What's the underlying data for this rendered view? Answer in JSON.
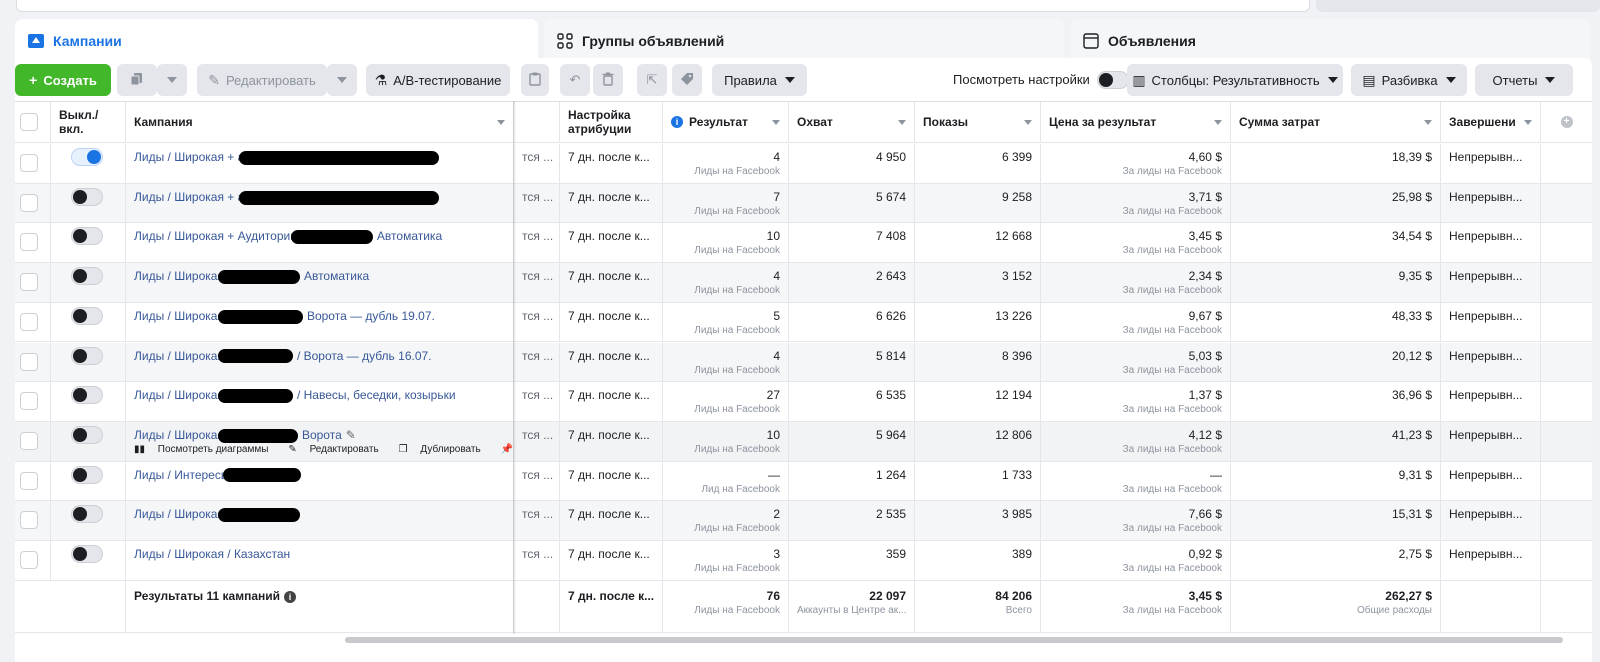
{
  "tabs": [
    {
      "label": "Кампании",
      "icon": "folder-icon",
      "active": true
    },
    {
      "label": "Группы объявлений",
      "icon": "grid-icon"
    },
    {
      "label": "Объявления",
      "icon": "ad-window-icon"
    }
  ],
  "toolbar": {
    "create_label": "Создать",
    "edit_label": "Редактировать",
    "ab_test_label": "A/B-тестирование",
    "rules_label": "Правила",
    "view_settings_label": "Посмотреть настройки",
    "columns_label": "Столбцы: Результативность",
    "breakdown_label": "Разбивка",
    "reports_label": "Отчеты"
  },
  "columns": {
    "onoff": "Выкл./ вкл.",
    "campaign": "Кампания",
    "attribution": "Настройка атрибуции",
    "result": "Результат",
    "reach": "Охват",
    "impressions": "Показы",
    "cost_per_result": "Цена за результат",
    "spend": "Сумма затрат",
    "ends": "Завершени"
  },
  "rows": [
    {
      "on": true,
      "name": "Лиды / Широкая + аудит.",
      "name_suffix": "",
      "delivery": "тся ...",
      "attribution": "7 дн. после к...",
      "result": "4",
      "result_sub": "Лиды на Facebook",
      "reach": "4 950",
      "impressions": "6 399",
      "cpr": "4,60 $",
      "cpr_sub": "За лиды на Facebook",
      "spend": "18,39 $",
      "ends": "Непрерывн..."
    },
    {
      "on": false,
      "name": "Лиды / Широкая + аудит.",
      "name_suffix": "",
      "delivery": "тся ...",
      "attribution": "7 дн. после к...",
      "result": "7",
      "result_sub": "Лиды на Facebook",
      "reach": "5 674",
      "impressions": "9 258",
      "cpr": "3,71 $",
      "cpr_sub": "За лиды на Facebook",
      "spend": "25,98 $",
      "ends": "Непрерывн..."
    },
    {
      "on": false,
      "name": "Лиды / Широкая + Аудитории",
      "name_suffix": "Автоматика",
      "delivery": "тся ...",
      "attribution": "7 дн. после к...",
      "result": "10",
      "result_sub": "Лиды на Facebook",
      "reach": "7 408",
      "impressions": "12 668",
      "cpr": "3,45 $",
      "cpr_sub": "За лиды на Facebook",
      "spend": "34,54 $",
      "ends": "Непрерывн..."
    },
    {
      "on": false,
      "name": "Лиды / Широкая",
      "name_suffix": "Автоматика",
      "delivery": "тся ...",
      "attribution": "7 дн. после к...",
      "result": "4",
      "result_sub": "Лиды на Facebook",
      "reach": "2 643",
      "impressions": "3 152",
      "cpr": "2,34 $",
      "cpr_sub": "За лиды на Facebook",
      "spend": "9,35 $",
      "ends": "Непрерывн..."
    },
    {
      "on": false,
      "name": "Лиды / Широкая",
      "name_suffix": "Ворота — дубль 19.07.",
      "delivery": "тся ...",
      "attribution": "7 дн. после к...",
      "result": "5",
      "result_sub": "Лиды на Facebook",
      "reach": "6 626",
      "impressions": "13 226",
      "cpr": "9,67 $",
      "cpr_sub": "За лиды на Facebook",
      "spend": "48,33 $",
      "ends": "Непрерывн..."
    },
    {
      "on": false,
      "name": "Лиды / Широкая",
      "name_suffix": "/ Ворота — дубль 16.07.",
      "delivery": "тся ...",
      "attribution": "7 дн. после к...",
      "result": "4",
      "result_sub": "Лиды на Facebook",
      "reach": "5 814",
      "impressions": "8 396",
      "cpr": "5,03 $",
      "cpr_sub": "За лиды на Facebook",
      "spend": "20,12 $",
      "ends": "Непрерывн..."
    },
    {
      "on": false,
      "name": "Лиды / Широкая",
      "name_suffix": "/ Навесы, беседки, козырьки",
      "delivery": "тся ...",
      "attribution": "7 дн. после к...",
      "result": "27",
      "result_sub": "Лиды на Facebook",
      "reach": "6 535",
      "impressions": "12 194",
      "cpr": "1,37 $",
      "cpr_sub": "За лиды на Facebook",
      "spend": "36,96 $",
      "ends": "Непрерывн..."
    },
    {
      "on": false,
      "name": "Лиды / Широкая",
      "name_suffix": "Ворота",
      "delivery": "тся ...",
      "attribution": "7 дн. после к...",
      "result": "10",
      "result_sub": "Лиды на Facebook",
      "reach": "5 964",
      "impressions": "12 806",
      "cpr": "4,12 $",
      "cpr_sub": "За лиды на Facebook",
      "spend": "41,23 $",
      "ends": "Непрерывн..."
    },
    {
      "on": false,
      "name": "Лиды / Интересы",
      "name_suffix": "",
      "delivery": "тся ...",
      "attribution": "7 дн. после к...",
      "result": "—",
      "result_sub": "Лид на Facebook",
      "reach": "1 264",
      "impressions": "1 733",
      "cpr": "—",
      "cpr_sub": "За лиды на Facebook",
      "spend": "9,31 $",
      "ends": "Непрерывн..."
    },
    {
      "on": false,
      "name": "Лиды / Широкая",
      "name_suffix": "",
      "delivery": "тся ...",
      "attribution": "7 дн. после к...",
      "result": "2",
      "result_sub": "Лиды на Facebook",
      "reach": "2 535",
      "impressions": "3 985",
      "cpr": "7,66 $",
      "cpr_sub": "За лиды на Facebook",
      "spend": "15,31 $",
      "ends": "Непрерывн..."
    },
    {
      "on": false,
      "name": "Лиды / Широкая / Казахстан",
      "name_suffix": "",
      "delivery": "тся ...",
      "attribution": "7 дн. после к...",
      "result": "3",
      "result_sub": "Лиды на Facebook",
      "reach": "359",
      "impressions": "389",
      "cpr": "0,92 $",
      "cpr_sub": "За лиды на Facebook",
      "spend": "2,75 $",
      "ends": "Непрерывн..."
    }
  ],
  "row_actions": {
    "charts": "Посмотреть диаграммы",
    "edit": "Редактировать",
    "duplicate": "Дублировать"
  },
  "totals": {
    "label": "Результаты 11 кампаний",
    "attribution": "7 дн. после к...",
    "result": "76",
    "result_sub": "Лиды на Facebook",
    "reach": "22 097",
    "reach_sub": "Аккаунты в Центре ак...",
    "impressions": "84 206",
    "impressions_sub": "Всего",
    "cpr": "3,45 $",
    "cpr_sub": "За лиды на Facebook",
    "spend": "262,27 $",
    "spend_sub": "Общие расходы"
  },
  "colors": {
    "accent": "#1b74e4",
    "create": "#42b72a",
    "link": "#385898"
  }
}
